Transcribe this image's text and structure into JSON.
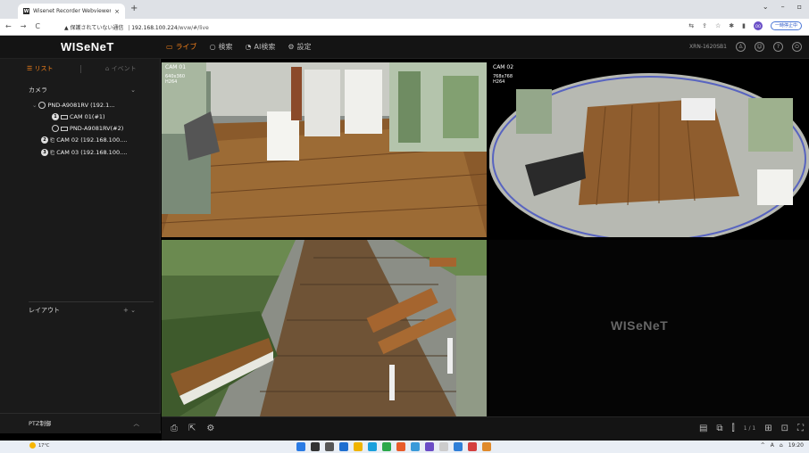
{
  "browser": {
    "tab_title": "Wisenet Recorder Webviewer",
    "tab_favicon": "W",
    "tab_close": "×",
    "new_tab": "+",
    "window_controls": [
      "⌄",
      "–",
      "▫"
    ],
    "nav": [
      "←",
      "→",
      "C"
    ],
    "security_text": "▲ 保護されていない通信",
    "url_host": "192.168.100.224",
    "url_path": "/wvw/#/live",
    "profile_initials": "OO",
    "update_label": "一時停止中"
  },
  "app": {
    "logo": "WISeNeT",
    "nav": [
      {
        "label": "ライブ",
        "icon": "monitor-icon",
        "glyph": "▭",
        "active": true
      },
      {
        "label": "検索",
        "icon": "search-icon",
        "glyph": "○",
        "active": false
      },
      {
        "label": "AI検索",
        "icon": "ai-search-icon",
        "glyph": "◔",
        "active": false
      },
      {
        "label": "設定",
        "icon": "gear-icon",
        "glyph": "⚙",
        "active": false
      }
    ],
    "model": "XRN-1620SB1",
    "header_icons": [
      "♙",
      "☺",
      "?",
      "⏻"
    ]
  },
  "sidebar": {
    "tab_list": "☰ リスト",
    "tab_event": "⌂ イベント",
    "camera_section": "カメラ",
    "layout_section": "レイアウト",
    "layout_add": "+",
    "ptz_label": "PTZ制御",
    "tree": [
      {
        "label": "PND-A9081RV (192.1...",
        "type": "nvr",
        "badge": ""
      },
      {
        "label": "CAM 01(#1)",
        "type": "channel",
        "badge": "1"
      },
      {
        "label": "PND-A9081RV(#2)",
        "type": "channel",
        "badge": ""
      },
      {
        "label": "CAM 02 (192.168.100....",
        "type": "camera",
        "badge": "2"
      },
      {
        "label": "CAM 03 (192.168.100....",
        "type": "camera",
        "badge": "3"
      }
    ]
  },
  "tiles": [
    {
      "label": "CAM 01",
      "res": "640x360",
      "codec": "H264"
    },
    {
      "label": "CAM 02",
      "res": "768x768",
      "codec": "H264"
    },
    {
      "label": "",
      "res": "",
      "codec": ""
    },
    {
      "label": "",
      "watermark": "WISeNeT"
    }
  ],
  "toolbar": {
    "page_indicator": "1 / 1"
  },
  "taskbar": {
    "temp": "17°C",
    "tray_lang": "A",
    "tray_time": "19:20"
  }
}
